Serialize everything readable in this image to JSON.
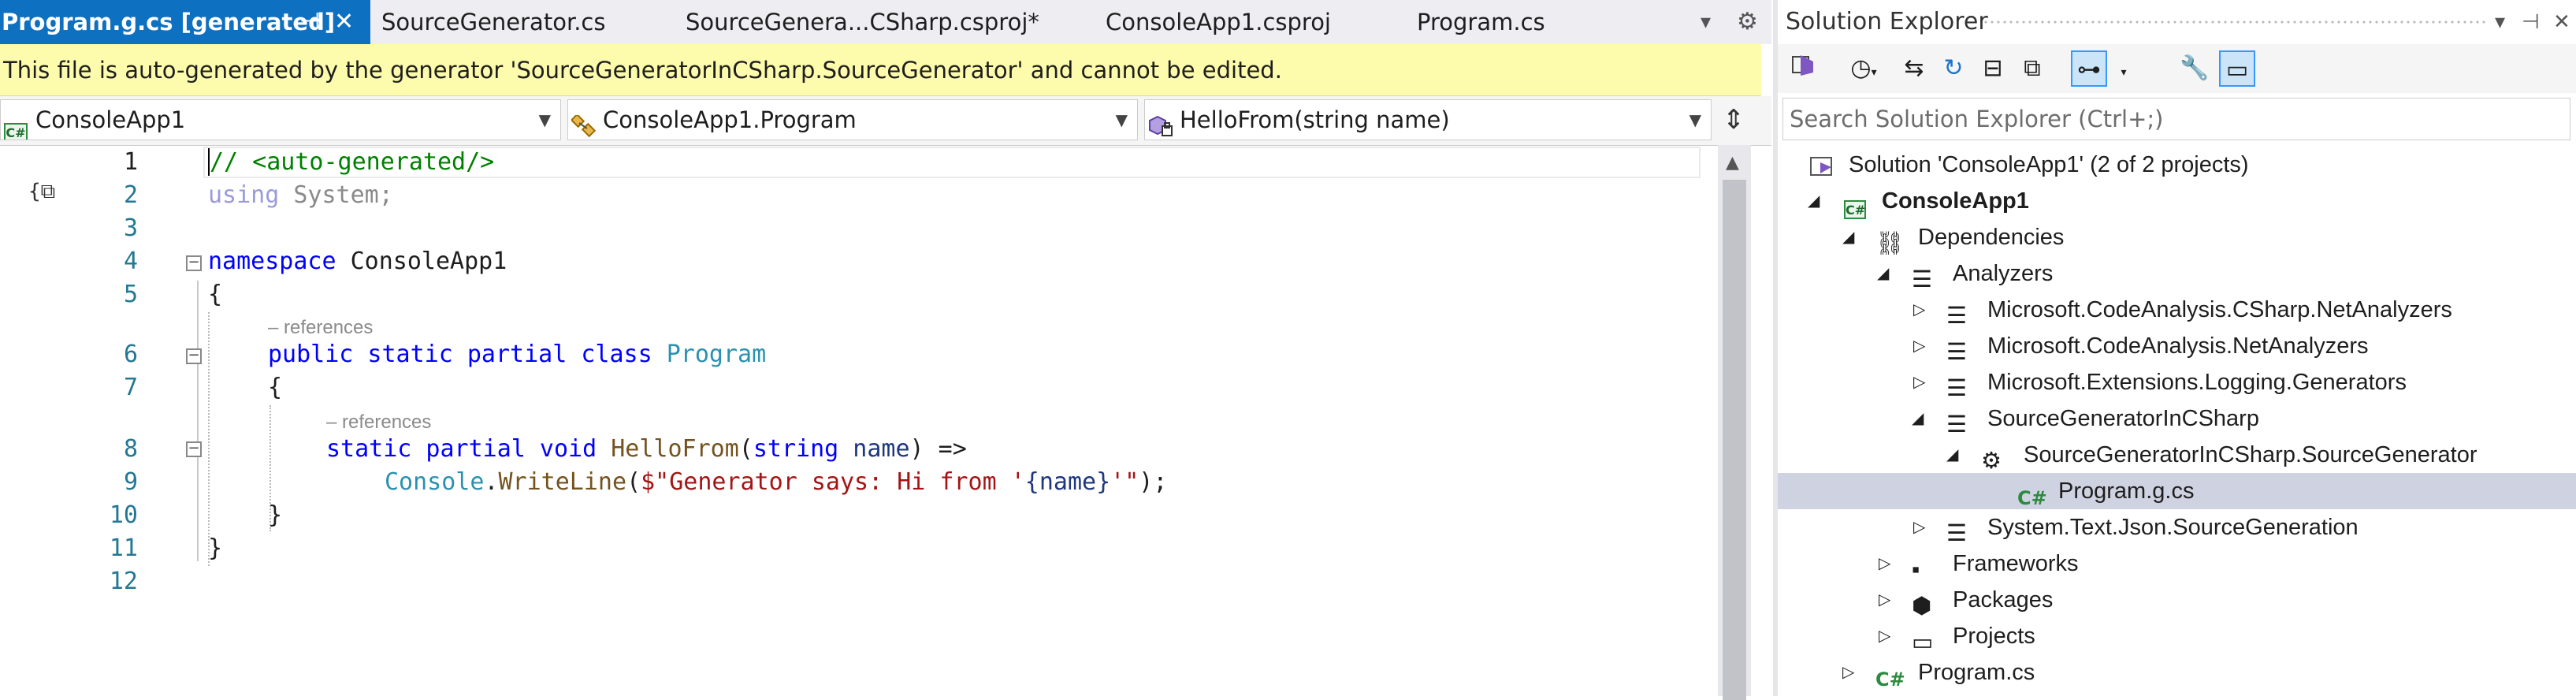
{
  "tabs": [
    {
      "label": "Program.g.cs [generated]",
      "active": true
    },
    {
      "label": "SourceGenerator.cs"
    },
    {
      "label": "SourceGenera...CSharp.csproj*"
    },
    {
      "label": "ConsoleApp1.csproj"
    },
    {
      "label": "Program.cs"
    }
  ],
  "infobar": {
    "message": "This file is auto-generated by the generator 'SourceGeneratorInCSharp.SourceGenerator' and cannot be edited."
  },
  "navbar": {
    "project": "ConsoleApp1",
    "type": "ConsoleApp1.Program",
    "member": "HelloFrom(string name)"
  },
  "code": {
    "line_numbers": [
      "1",
      "2",
      "3",
      "4",
      "5",
      "6",
      "7",
      "8",
      "9",
      "10",
      "11",
      "12"
    ],
    "references": "– references",
    "lines": {
      "l1": "// <auto-generated/>",
      "l2_kw": "using",
      "l2_ns": " System;",
      "l4_kw": "namespace",
      "l4_name": " ConsoleApp1",
      "l5": "{",
      "l6_mods": "public static partial class",
      "l6_name": " Program",
      "l7": "{",
      "l8_mods": "static partial void",
      "l8_method": " HelloFrom",
      "l8_open": "(",
      "l8_type": "string",
      "l8_param": " name",
      "l8_close": ") =>",
      "l9_type": "Console",
      "l9_dot": ".",
      "l9_method": "WriteLine",
      "l9_open": "(",
      "l9_str1": "$\"Generator says: Hi from '",
      "l9_interp": "{name}",
      "l9_str2": "'\"",
      "l9_close": ");",
      "l10": "}",
      "l11": "}"
    }
  },
  "solution_explorer": {
    "title": "Solution Explorer",
    "search_placeholder": "Search Solution Explorer (Ctrl+;)",
    "tree": [
      {
        "label": "Solution 'ConsoleApp1' (2 of 2 projects)"
      },
      {
        "label": "ConsoleApp1"
      },
      {
        "label": "Dependencies"
      },
      {
        "label": "Analyzers"
      },
      {
        "label": "Microsoft.CodeAnalysis.CSharp.NetAnalyzers"
      },
      {
        "label": "Microsoft.CodeAnalysis.NetAnalyzers"
      },
      {
        "label": "Microsoft.Extensions.Logging.Generators"
      },
      {
        "label": "SourceGeneratorInCSharp"
      },
      {
        "label": "SourceGeneratorInCSharp.SourceGenerator"
      },
      {
        "label": "Program.g.cs"
      },
      {
        "label": "System.Text.Json.SourceGeneration"
      },
      {
        "label": "Frameworks"
      },
      {
        "label": "Packages"
      },
      {
        "label": "Projects"
      },
      {
        "label": "Program.cs"
      }
    ]
  },
  "colors": {
    "accent": "#0e70c0",
    "infobar": "#fdfbac",
    "selection": "#cfd3e1"
  }
}
